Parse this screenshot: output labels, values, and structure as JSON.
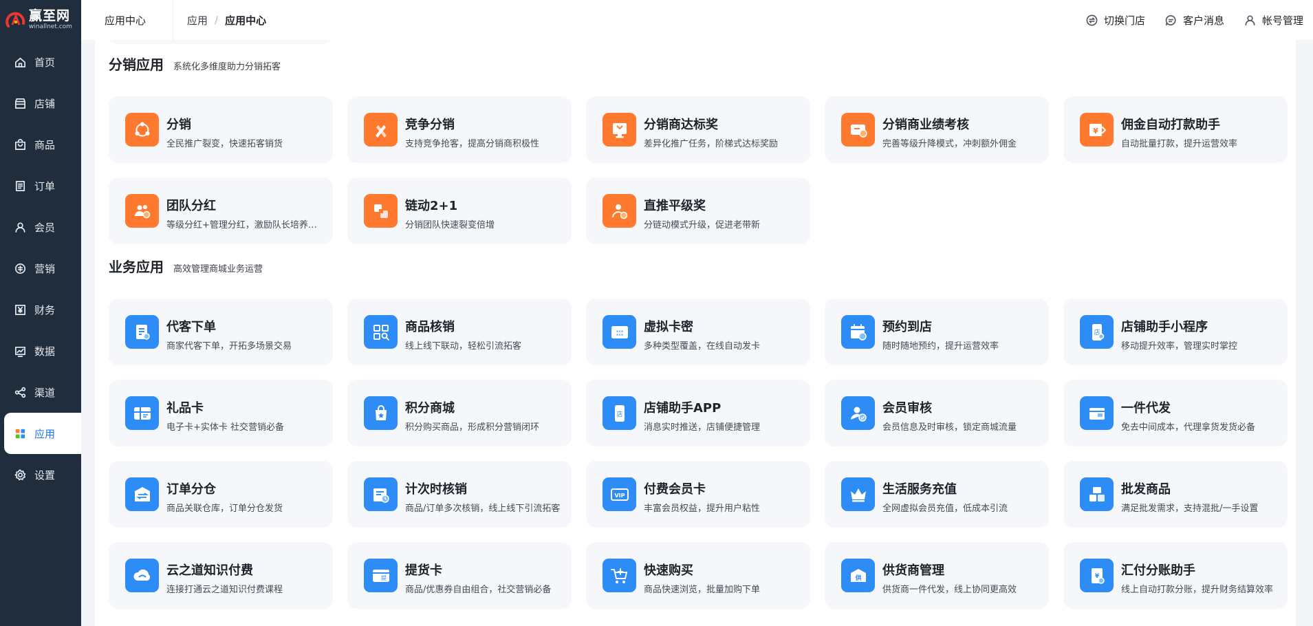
{
  "logo": {
    "name": "赢至网",
    "domain": "winallnet.com"
  },
  "sidebar": {
    "items": [
      {
        "label": "首页",
        "icon": "home-icon"
      },
      {
        "label": "店铺",
        "icon": "store-icon"
      },
      {
        "label": "商品",
        "icon": "bag-icon"
      },
      {
        "label": "订单",
        "icon": "order-icon"
      },
      {
        "label": "会员",
        "icon": "user-icon"
      },
      {
        "label": "营销",
        "icon": "marketing-icon"
      },
      {
        "label": "财务",
        "icon": "finance-icon"
      },
      {
        "label": "数据",
        "icon": "chart-icon"
      },
      {
        "label": "渠道",
        "icon": "channel-icon"
      },
      {
        "label": "应用",
        "icon": "apps-icon",
        "active": true
      },
      {
        "label": "设置",
        "icon": "gear-icon"
      }
    ]
  },
  "header": {
    "section": "应用中心",
    "breadcrumb": [
      "应用",
      "应用中心"
    ],
    "actions": [
      {
        "label": "切换门店",
        "icon": "switch-store-icon"
      },
      {
        "label": "客户消息",
        "icon": "message-icon"
      },
      {
        "label": "帐号管理",
        "icon": "account-icon"
      }
    ]
  },
  "colors": {
    "accent": "#1677ff",
    "orange": "#ff7a2e",
    "blue": "#2e8cf7",
    "sidebar": "#1f2d3d"
  },
  "sections": [
    {
      "title": "分销应用",
      "subtitle": "系统化多维度助力分销拓客",
      "color": "orange",
      "apps": [
        {
          "title": "分销",
          "desc": "全民推广裂变，快速拓客销货"
        },
        {
          "title": "竞争分销",
          "desc": "支持竞争抢客，提高分销商积极性"
        },
        {
          "title": "分销商达标奖",
          "desc": "差异化推广任务，阶梯式达标奖励"
        },
        {
          "title": "分销商业绩考核",
          "desc": "完善等级升降模式，冲刺额外佣金"
        },
        {
          "title": "佣金自动打款助手",
          "desc": "自动批量打款，提升运营效率"
        },
        {
          "title": "团队分红",
          "desc": "等级分红+管理分红，激励队长培养团队"
        },
        {
          "title": "链动2+1",
          "desc": "分销团队快速裂变倍增"
        },
        {
          "title": "直推平级奖",
          "desc": "分链动模式升级，促进老带新"
        }
      ]
    },
    {
      "title": "业务应用",
      "subtitle": "高效管理商城业务运营",
      "color": "blue",
      "apps": [
        {
          "title": "代客下单",
          "desc": "商家代客下单，开拓多场景交易"
        },
        {
          "title": "商品核销",
          "desc": "线上线下联动，轻松引流拓客"
        },
        {
          "title": "虚拟卡密",
          "desc": "多种类型覆盖，在线自动发卡"
        },
        {
          "title": "预约到店",
          "desc": "随时随地预约，提升运营效率"
        },
        {
          "title": "店铺助手小程序",
          "desc": "移动提升效率，管理实时掌控"
        },
        {
          "title": "礼品卡",
          "desc": "电子卡+实体卡 社交营销必备"
        },
        {
          "title": "积分商城",
          "desc": "积分购买商品，形成积分营销闭环"
        },
        {
          "title": "店铺助手APP",
          "desc": "消息实时推送，店铺便捷管理"
        },
        {
          "title": "会员审核",
          "desc": "会员信息及时审核，锁定商城流量"
        },
        {
          "title": "一件代发",
          "desc": "免去中间成本，代理拿货发货必备"
        },
        {
          "title": "订单分仓",
          "desc": "商品关联仓库，订单分仓发货"
        },
        {
          "title": "计次时核销",
          "desc": "商品/订单多次核销，线上线下引流拓客"
        },
        {
          "title": "付费会员卡",
          "desc": "丰富会员权益，提升用户粘性"
        },
        {
          "title": "生活服务充值",
          "desc": "全网虚拟会员充值，低成本引流"
        },
        {
          "title": "批发商品",
          "desc": "满足批发需求，支持混批/一手设置"
        },
        {
          "title": "云之道知识付费",
          "desc": "连接打通云之道知识付费课程"
        },
        {
          "title": "提货卡",
          "desc": "商品/优惠券自由组合，社交营销必备"
        },
        {
          "title": "快速购买",
          "desc": "商品快速浏览，批量加购下单"
        },
        {
          "title": "供货商管理",
          "desc": "供货商一件代发，线上协同更高效"
        },
        {
          "title": "汇付分账助手",
          "desc": "线上自动打款分账，提升财务结算效率"
        }
      ]
    }
  ]
}
